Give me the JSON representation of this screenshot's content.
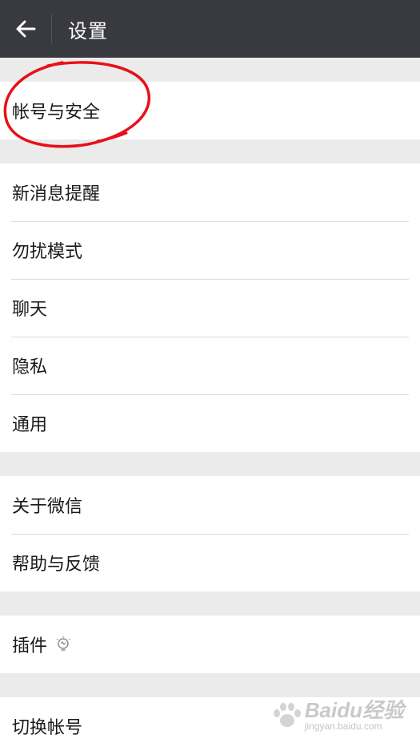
{
  "header": {
    "back_icon": "arrow-left-icon",
    "title": "设置"
  },
  "groups": [
    {
      "items": [
        {
          "label": "帐号与安全"
        }
      ]
    },
    {
      "items": [
        {
          "label": "新消息提醒"
        },
        {
          "label": "勿扰模式"
        },
        {
          "label": "聊天"
        },
        {
          "label": "隐私"
        },
        {
          "label": "通用"
        }
      ]
    },
    {
      "items": [
        {
          "label": "关于微信"
        },
        {
          "label": "帮助与反馈"
        }
      ]
    },
    {
      "items": [
        {
          "label": "插件",
          "icon": "lightbulb-icon"
        }
      ]
    },
    {
      "items": [
        {
          "label": "切换帐号"
        }
      ]
    }
  ],
  "colors": {
    "header_bg": "#393a3f",
    "page_bg": "#ebebeb",
    "annotation": "#e8101a"
  },
  "watermark": {
    "brand": "Baidu经验",
    "url": "jingyan.baidu.com"
  }
}
